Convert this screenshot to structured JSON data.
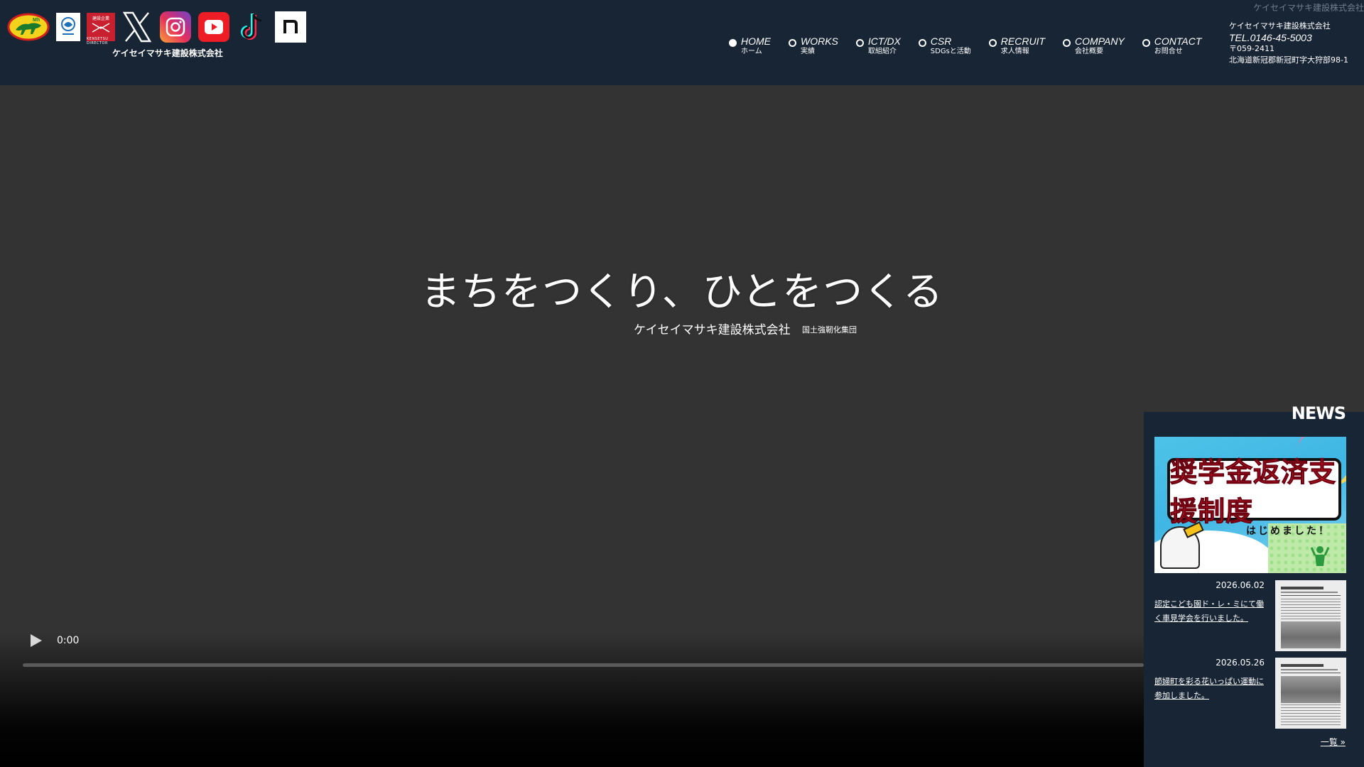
{
  "header": {
    "corner_text": "ケイセイマサキ建設株式会社",
    "company_under_logos": "ケイセイマサキ建設株式会社",
    "logos": {
      "mh": "Mh",
      "director_top": "建設企業",
      "director_bottom": "KENSETSU DIRECTOR"
    },
    "social": [
      {
        "name": "x-icon"
      },
      {
        "name": "instagram-icon"
      },
      {
        "name": "youtube-icon"
      },
      {
        "name": "tiktok-icon"
      },
      {
        "name": "note-icon"
      }
    ],
    "nav": [
      {
        "en": "HOME",
        "ja": "ホーム",
        "active": true
      },
      {
        "en": "WORKS",
        "ja": "実績",
        "active": false
      },
      {
        "en": "ICT/DX",
        "ja": "取組紹介",
        "active": false
      },
      {
        "en": "CSR",
        "ja": "SDGsと活動",
        "active": false
      },
      {
        "en": "RECRUIT",
        "ja": "求人情報",
        "active": false
      },
      {
        "en": "COMPANY",
        "ja": "会社概要",
        "active": false
      },
      {
        "en": "CONTACT",
        "ja": "お問合せ",
        "active": false
      }
    ],
    "contact": {
      "company": "ケイセイマサキ建設株式会社",
      "tel": "TEL.0146-45-5003",
      "zip": "〒059-2411",
      "address": "北海道新冠郡新冠町字大狩部98-1"
    }
  },
  "hero": {
    "catch": "まちをつくり、ひとをつくる",
    "company": "ケイセイマサキ建設株式会社",
    "tag": "国土強靭化集団"
  },
  "video": {
    "time": "0:00"
  },
  "news": {
    "title": "NEWS",
    "feature_text": "奨学金返済支援制度",
    "feature_sub": "はじめました！",
    "items": [
      {
        "date": "2026.06.02",
        "title": "認定こども園ド・レ・ミにて働く車見学会を行いました。"
      },
      {
        "date": "2026.05.26",
        "title": "節婦町を彩る花いっぱい運動に参加しました。"
      }
    ],
    "more": "一覧 »"
  },
  "colors": {
    "header_bg": "#182535",
    "hero_bg": "#333333",
    "youtube": "#ee1d25",
    "director": "#c8202f"
  }
}
